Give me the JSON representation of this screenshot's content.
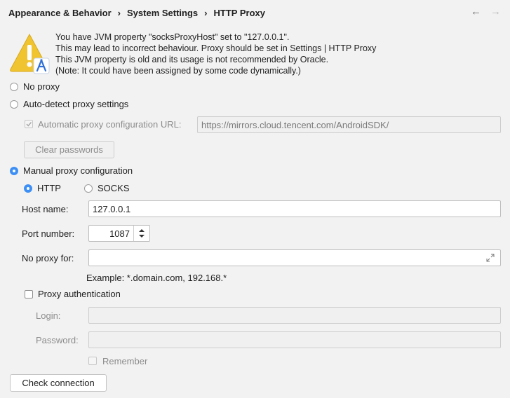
{
  "breadcrumb": {
    "items": [
      "Appearance & Behavior",
      "System Settings",
      "HTTP Proxy"
    ],
    "separator": "›"
  },
  "nav": {
    "back": "←",
    "forward": "→"
  },
  "warning": {
    "lines": [
      "You have JVM property \"socksProxyHost\" set to \"127.0.0.1\".",
      "This may lead to incorrect behaviour. Proxy should be set in Settings | HTTP Proxy",
      "This JVM property is old and its usage is not recommended by Oracle.",
      "(Note: It could have been assigned by some code dynamically.)"
    ]
  },
  "options": {
    "no_proxy": "No proxy",
    "auto_detect": "Auto-detect proxy settings",
    "auto_config_url_label": "Automatic proxy configuration URL:",
    "auto_config_url_value": "https://mirrors.cloud.tencent.com/AndroidSDK/",
    "clear_passwords": "Clear passwords",
    "manual": "Manual proxy configuration",
    "http": "HTTP",
    "socks": "SOCKS"
  },
  "form": {
    "host_label": "Host name:",
    "host_value": "127.0.0.1",
    "port_label": "Port number:",
    "port_value": "1087",
    "no_proxy_label": "No proxy for:",
    "no_proxy_value": "",
    "example": "Example: *.domain.com, 192.168.*",
    "proxy_auth": "Proxy authentication",
    "login_label": "Login:",
    "password_label": "Password:",
    "remember": "Remember",
    "check_connection": "Check connection"
  },
  "colors": {
    "accent": "#3d8ff5",
    "warning": "#f0c431",
    "background": "#f2f2f2"
  }
}
